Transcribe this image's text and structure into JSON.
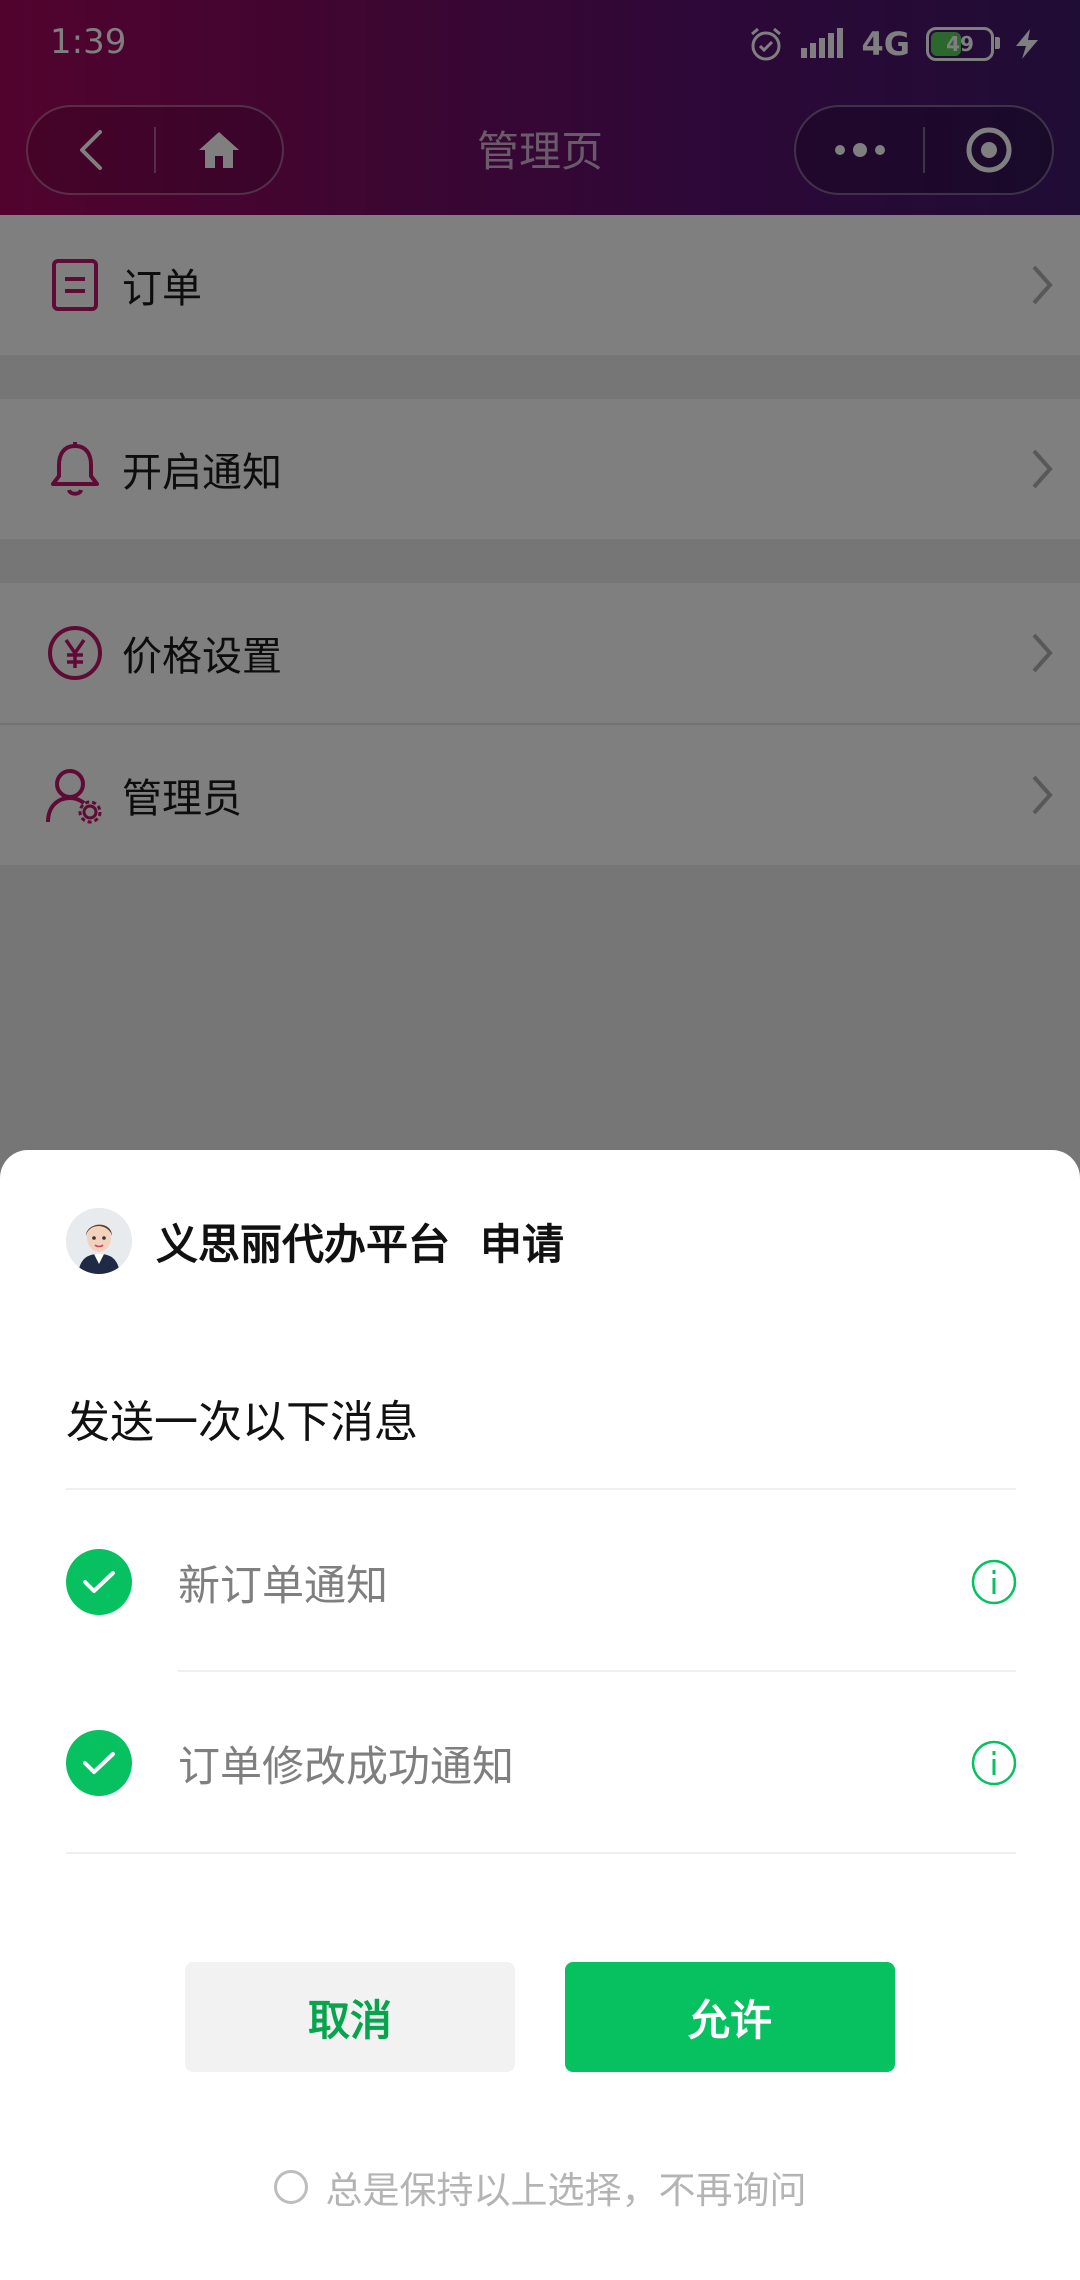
{
  "status_bar": {
    "time": "1:39",
    "network": "4G",
    "battery_level": 49
  },
  "nav": {
    "title": "管理页"
  },
  "menu": [
    {
      "label": "订单",
      "icon": "order-doc-icon"
    },
    {
      "label": "开启通知",
      "icon": "bell-icon"
    },
    {
      "label": "价格设置",
      "icon": "yen-icon"
    },
    {
      "label": "管理员",
      "icon": "admin-user-icon"
    }
  ],
  "dialog": {
    "app_name": "义思丽代办平台",
    "action": "申请",
    "subtitle": "发送一次以下消息",
    "messages": [
      {
        "label": "新订单通知",
        "checked": true
      },
      {
        "label": "订单修改成功通知",
        "checked": true
      }
    ],
    "cancel_label": "取消",
    "allow_label": "允许",
    "remember_label": "总是保持以上选择，不再询问"
  },
  "colors": {
    "accent": "#c0176b",
    "wechat_green": "#07c160",
    "header_start": "#a3075c",
    "header_end": "#3f1a6b"
  }
}
